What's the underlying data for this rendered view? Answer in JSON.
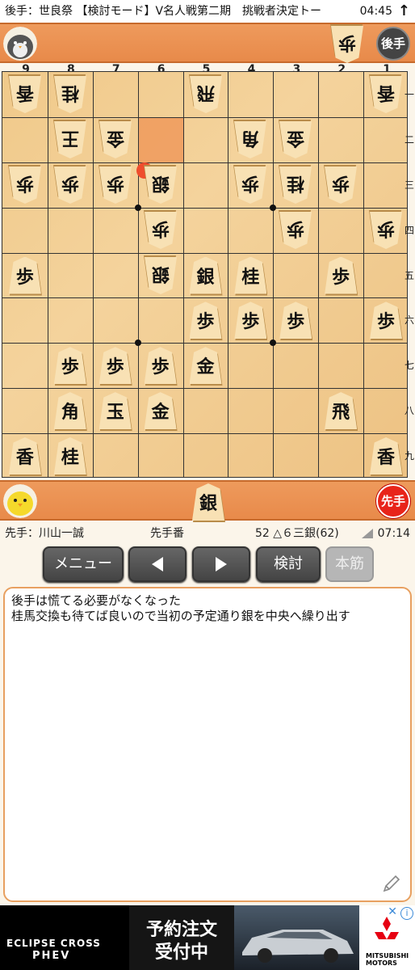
{
  "status_bar": {
    "title": "後手：世良祭 【検討モード】V名人戦第二期　挑戦者決定トー",
    "time": "04:45",
    "arrow": "↑"
  },
  "gote_hand": {
    "pieces": [
      "歩"
    ],
    "badge": "後手"
  },
  "sente_hand": {
    "pieces": [
      "銀"
    ],
    "badge": "先手"
  },
  "board": {
    "files": [
      "9",
      "8",
      "7",
      "6",
      "5",
      "4",
      "3",
      "2",
      "1"
    ],
    "ranks": [
      "一",
      "二",
      "三",
      "四",
      "五",
      "六",
      "七",
      "八",
      "九"
    ],
    "highlight_square": {
      "file": 6,
      "rank": 2
    },
    "last_move_square": {
      "file": 6,
      "rank": 3
    },
    "pieces": [
      {
        "file": 9,
        "rank": 1,
        "kind": "香",
        "owner": "gote"
      },
      {
        "file": 8,
        "rank": 1,
        "kind": "桂",
        "owner": "gote"
      },
      {
        "file": 5,
        "rank": 1,
        "kind": "飛",
        "owner": "gote"
      },
      {
        "file": 1,
        "rank": 1,
        "kind": "香",
        "owner": "gote"
      },
      {
        "file": 8,
        "rank": 2,
        "kind": "王",
        "owner": "gote"
      },
      {
        "file": 7,
        "rank": 2,
        "kind": "金",
        "owner": "gote"
      },
      {
        "file": 4,
        "rank": 2,
        "kind": "角",
        "owner": "gote"
      },
      {
        "file": 3,
        "rank": 2,
        "kind": "金",
        "owner": "gote"
      },
      {
        "file": 9,
        "rank": 3,
        "kind": "歩",
        "owner": "gote"
      },
      {
        "file": 8,
        "rank": 3,
        "kind": "歩",
        "owner": "gote"
      },
      {
        "file": 7,
        "rank": 3,
        "kind": "歩",
        "owner": "gote"
      },
      {
        "file": 6,
        "rank": 3,
        "kind": "銀",
        "owner": "gote"
      },
      {
        "file": 4,
        "rank": 3,
        "kind": "歩",
        "owner": "gote"
      },
      {
        "file": 3,
        "rank": 3,
        "kind": "桂",
        "owner": "gote"
      },
      {
        "file": 2,
        "rank": 3,
        "kind": "歩",
        "owner": "gote"
      },
      {
        "file": 6,
        "rank": 4,
        "kind": "歩",
        "owner": "gote"
      },
      {
        "file": 3,
        "rank": 4,
        "kind": "歩",
        "owner": "gote"
      },
      {
        "file": 1,
        "rank": 4,
        "kind": "歩",
        "owner": "gote"
      },
      {
        "file": 6,
        "rank": 5,
        "kind": "銀",
        "owner": "gote"
      },
      {
        "file": 9,
        "rank": 5,
        "kind": "歩",
        "owner": "sente"
      },
      {
        "file": 5,
        "rank": 5,
        "kind": "銀",
        "owner": "sente"
      },
      {
        "file": 4,
        "rank": 5,
        "kind": "桂",
        "owner": "sente"
      },
      {
        "file": 2,
        "rank": 5,
        "kind": "歩",
        "owner": "sente"
      },
      {
        "file": 5,
        "rank": 6,
        "kind": "歩",
        "owner": "sente"
      },
      {
        "file": 4,
        "rank": 6,
        "kind": "歩",
        "owner": "sente"
      },
      {
        "file": 3,
        "rank": 6,
        "kind": "歩",
        "owner": "sente"
      },
      {
        "file": 1,
        "rank": 6,
        "kind": "歩",
        "owner": "sente"
      },
      {
        "file": 8,
        "rank": 7,
        "kind": "歩",
        "owner": "sente"
      },
      {
        "file": 7,
        "rank": 7,
        "kind": "歩",
        "owner": "sente"
      },
      {
        "file": 6,
        "rank": 7,
        "kind": "歩",
        "owner": "sente"
      },
      {
        "file": 5,
        "rank": 7,
        "kind": "金",
        "owner": "sente"
      },
      {
        "file": 8,
        "rank": 8,
        "kind": "角",
        "owner": "sente"
      },
      {
        "file": 7,
        "rank": 8,
        "kind": "玉",
        "owner": "sente"
      },
      {
        "file": 6,
        "rank": 8,
        "kind": "金",
        "owner": "sente"
      },
      {
        "file": 2,
        "rank": 8,
        "kind": "飛",
        "owner": "sente"
      },
      {
        "file": 9,
        "rank": 9,
        "kind": "香",
        "owner": "sente"
      },
      {
        "file": 8,
        "rank": 9,
        "kind": "桂",
        "owner": "sente"
      },
      {
        "file": 1,
        "rank": 9,
        "kind": "香",
        "owner": "sente"
      }
    ]
  },
  "info": {
    "player": "先手：川山一誠",
    "turn": "先手番",
    "move": "52 △６三銀(62)",
    "time": "07:14"
  },
  "buttons": {
    "menu": "メニュー",
    "kento": "検討",
    "honsuji": "本筋"
  },
  "comment": {
    "lines": [
      "後手は慌てる必要がなくなった",
      "桂馬交換も待てば良いので当初の予定通り銀を中央へ繰り出す"
    ]
  },
  "ad": {
    "brand1": "ECLIPSE CROSS",
    "brand2": "PHEV",
    "text1": "予約注文",
    "text2": "受付中",
    "maker": "MITSUBISHI MOTORS",
    "info_icon": "info-icon",
    "close_icon": "close-icon"
  },
  "colors": {
    "hand_bar": "#e88a4a",
    "board": "#f0c98a",
    "highlight": "#ee9a5c",
    "last_move_dot": "#ef4d2d",
    "sente_badge": "#e8241a",
    "gote_badge": "#444444"
  }
}
